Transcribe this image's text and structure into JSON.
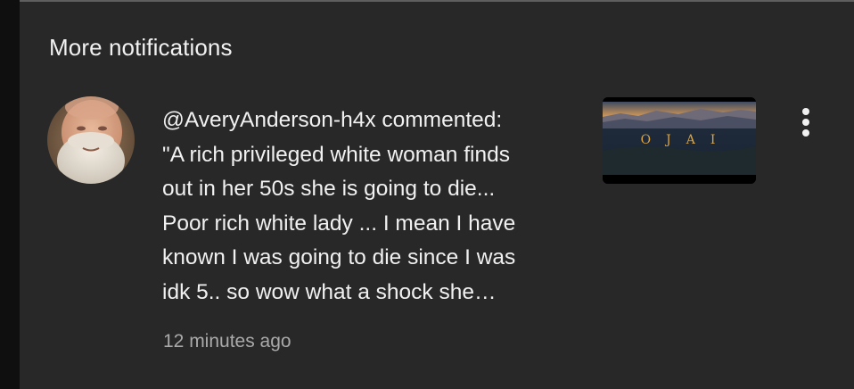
{
  "section": {
    "title": "More notifications"
  },
  "notification": {
    "avatar_icon": "user-avatar",
    "comment_lines": [
      "@AveryAnderson-h4x commented:",
      "\"A rich privileged white woman finds",
      "out in her 50s she is going to die...",
      "Poor rich white lady ... I mean I have",
      "known I was going to die since I was",
      "idk 5.. so wow what a shock she…"
    ],
    "timestamp": "12 minutes ago",
    "thumbnail": {
      "title_text": "OJAI",
      "title_color": "#d9a441"
    },
    "menu_icon": "more-vertical-icon"
  },
  "colors": {
    "background": "#282828",
    "sidebar": "#0f0f0f",
    "text_primary": "#f1f1f1",
    "text_secondary": "#aaaaaa"
  }
}
